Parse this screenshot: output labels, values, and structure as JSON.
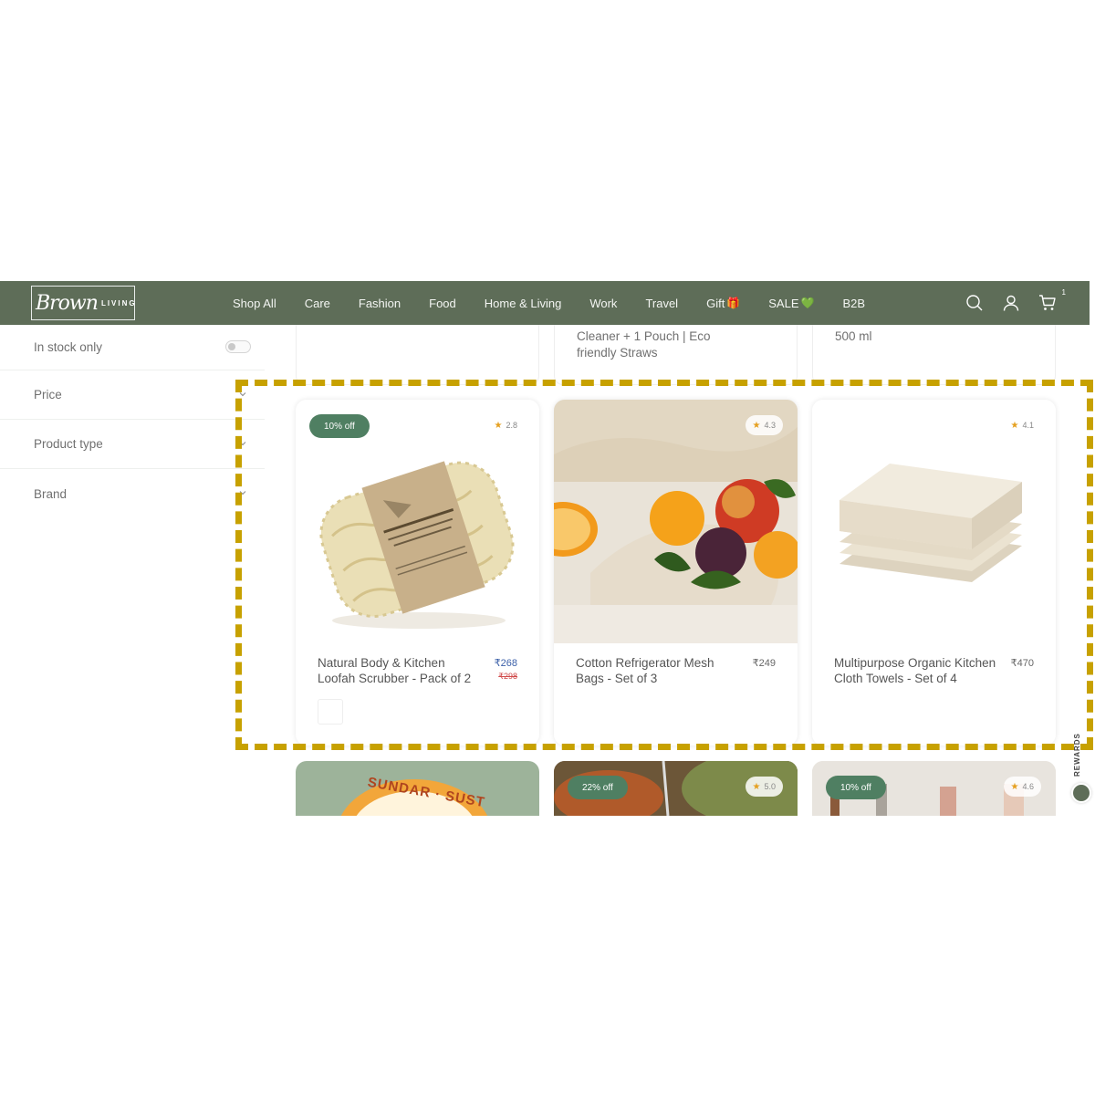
{
  "header": {
    "logo_script": "Brown",
    "logo_sub": "LIVING",
    "nav": [
      {
        "label": "Shop All"
      },
      {
        "label": "Care"
      },
      {
        "label": "Fashion"
      },
      {
        "label": "Food"
      },
      {
        "label": "Home & Living"
      },
      {
        "label": "Work"
      },
      {
        "label": "Travel"
      },
      {
        "label": "Gift",
        "emoji": "🎁"
      },
      {
        "label": "SALE",
        "emoji": "💚"
      },
      {
        "label": "B2B"
      }
    ],
    "cart_count": "1",
    "icons": [
      "search-icon",
      "account-icon",
      "cart-icon"
    ]
  },
  "filters": {
    "in_stock_label": "In stock only",
    "price_label": "Price",
    "product_type_label": "Product type",
    "brand_label": "Brand"
  },
  "top_cards": {
    "middle_text_line1": "Cleaner + 1 Pouch | Eco",
    "middle_text_line2": "friendly Straws",
    "right_text": "500 ml"
  },
  "products": [
    {
      "badge": "10% off",
      "rating": "2.8",
      "title": "Natural Body & Kitchen Loofah Scrubber - Pack of 2",
      "price": "₹268",
      "old_price": "₹298"
    },
    {
      "rating": "4.3",
      "title": "Cotton Refrigerator Mesh Bags - Set of 3",
      "price": "₹249"
    },
    {
      "rating": "4.1",
      "title": "Multipurpose Organic Kitchen Cloth Towels - Set of 4",
      "price": "₹470"
    }
  ],
  "bottom_cards": [
    {
      "art_text": "SUNDAR · SUST"
    },
    {
      "badge": "22% off",
      "rating": "5.0"
    },
    {
      "badge": "10% off",
      "rating": "4.6"
    }
  ],
  "rewards_label": "REWARDS",
  "colors": {
    "header_bg": "#5e6d58",
    "badge_green": "#4f7f62",
    "highlight_dash": "#c7a100",
    "star": "#e5a020"
  }
}
